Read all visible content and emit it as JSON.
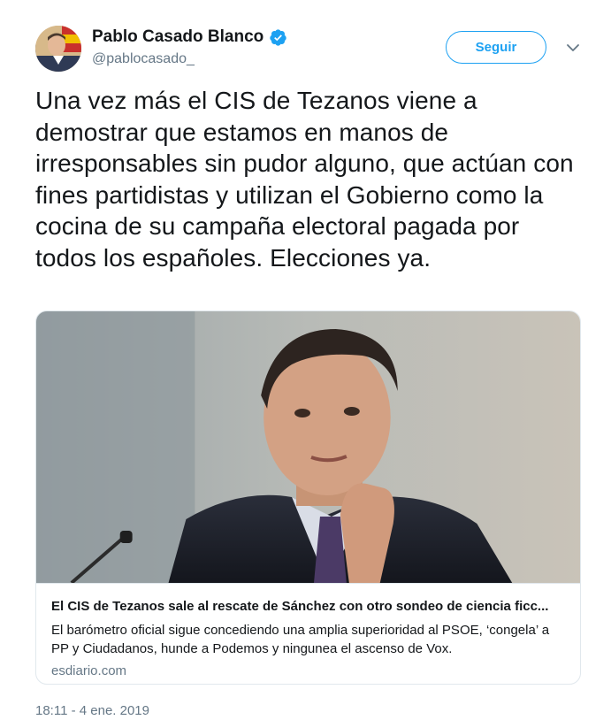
{
  "author": {
    "display_name": "Pablo Casado Blanco",
    "handle": "@pablocasado_",
    "verified": true
  },
  "actions": {
    "follow_label": "Seguir",
    "menu_icon": "chevron-down-icon"
  },
  "tweet": {
    "text": "Una vez más el CIS de Tezanos viene a demostrar que estamos en manos de irresponsables sin pudor alguno, que actúan con fines partidistas y utilizan el Gobierno como la cocina de su campaña electoral pagada por todos los españoles. Elecciones ya.",
    "timestamp": "18:11 - 4 ene. 2019"
  },
  "card": {
    "title": "El CIS de Tezanos sale al rescate de Sánchez con otro sondeo de ciencia ficc...",
    "description": "El barómetro oficial sigue concediendo una amplia superioridad al PSOE, ‘congela’ a PP y Ciudadanos, hunde a Podemos y ningunea el ascenso de Vox.",
    "domain": "esdiario.com"
  },
  "colors": {
    "accent": "#1da1f2",
    "text": "#14171a",
    "secondary": "#657786",
    "border": "#e1e8ed"
  }
}
